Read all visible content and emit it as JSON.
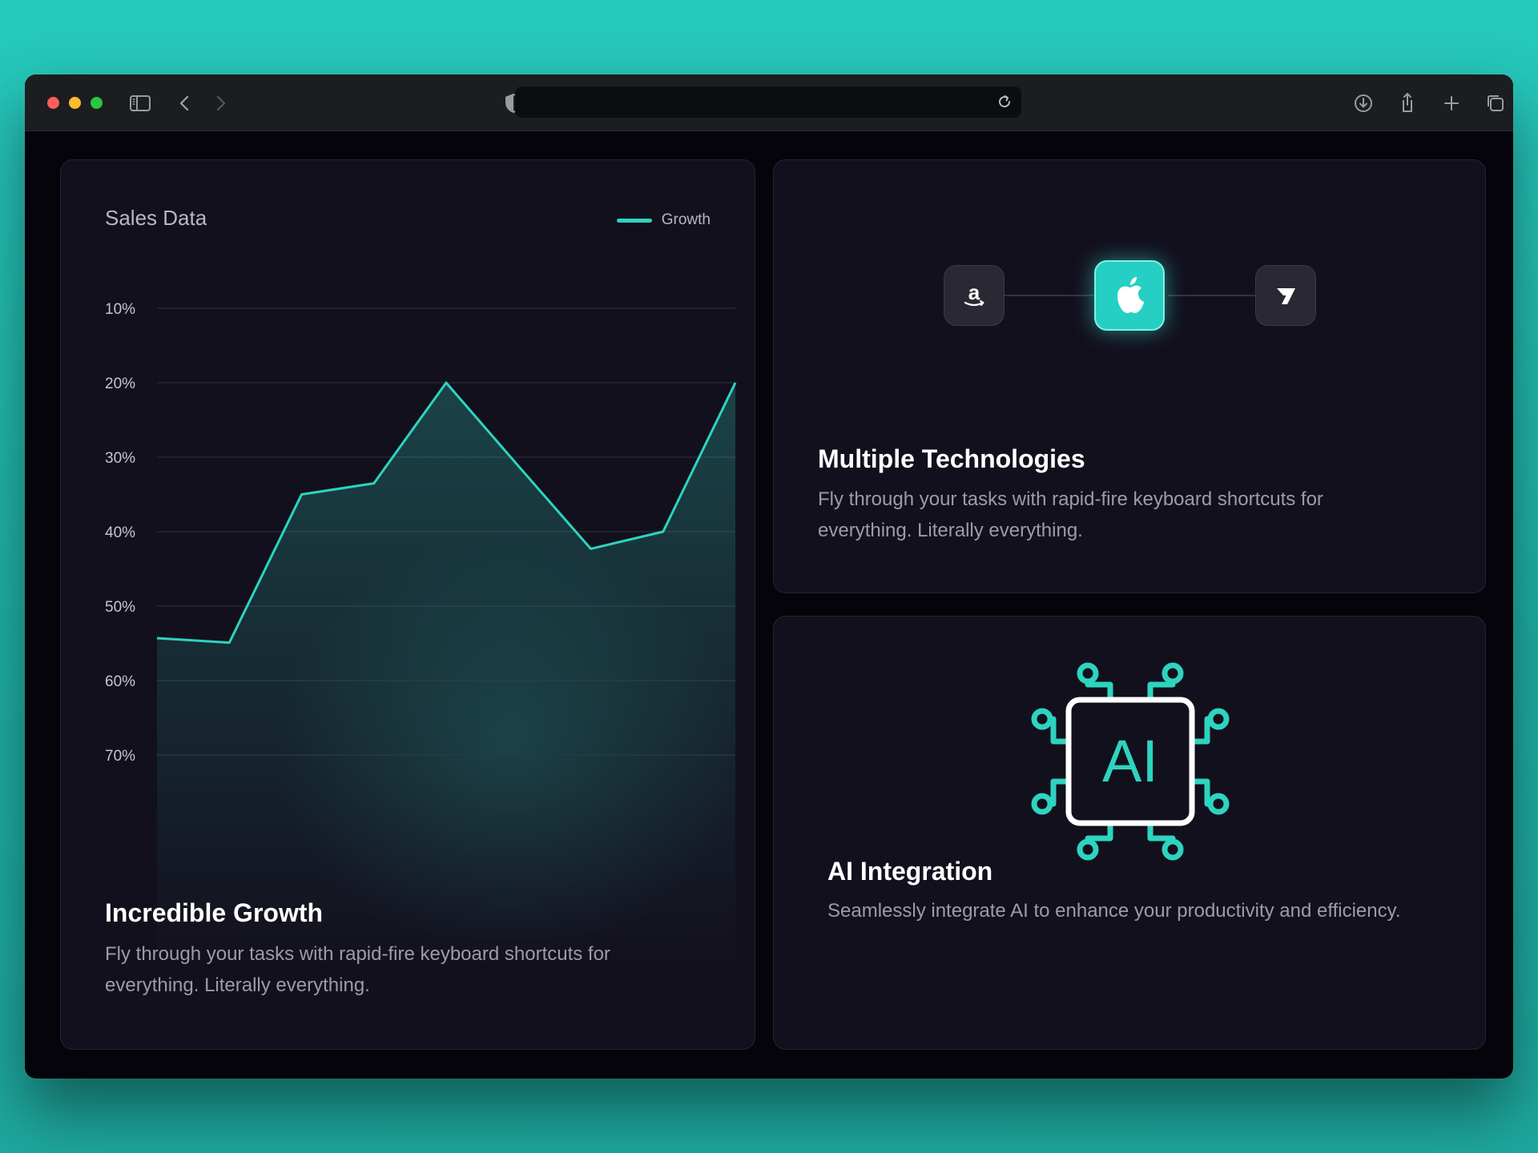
{
  "browser": {
    "address_value": ""
  },
  "sales_card": {
    "chart_data": {
      "type": "area",
      "title": "Sales Data",
      "legend": [
        {
          "name": "Growth",
          "color": "#2dd4bf"
        }
      ],
      "legend_placement": "top-right",
      "y_ticks": [
        "10%",
        "20%",
        "30%",
        "40%",
        "50%",
        "60%",
        "70%"
      ],
      "y_tick_values": [
        10,
        20,
        30,
        40,
        50,
        60,
        70
      ],
      "ylim": [
        10,
        70
      ],
      "y_inverted": true,
      "grid": true,
      "series": [
        {
          "name": "Growth",
          "values": [
            54.3,
            54.9,
            35,
            33.5,
            20,
            31.2,
            42.3,
            40,
            20
          ]
        }
      ]
    },
    "title": "Incredible Growth",
    "description": "Fly through your tasks with rapid-fire keyboard shortcuts for everything. Literally everything."
  },
  "tech_card": {
    "icons": [
      "amazon-icon",
      "apple-icon",
      "wise-icon"
    ],
    "title": "Multiple Technologies",
    "description": "Fly through your tasks with rapid-fire keyboard shortcuts for everything. Literally everything."
  },
  "ai_card": {
    "chip_text": "AI",
    "title": "AI Integration",
    "description": "Seamlessly integrate AI to enhance your productivity and efficiency."
  },
  "colors": {
    "accent": "#2dd4bf",
    "card_bg": "#13101d",
    "page_bg": "#04040a"
  }
}
